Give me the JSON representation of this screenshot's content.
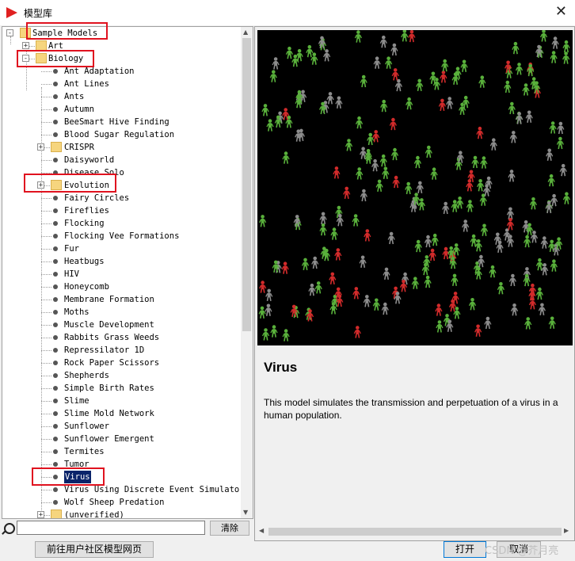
{
  "window": {
    "title": "模型库",
    "close_glyph": "✕",
    "app_icon": "netlogo-arrow-icon",
    "accent": "#e02020"
  },
  "tree": {
    "root": "Sample Models",
    "items": [
      {
        "label": "Sample Models",
        "level": 0,
        "kind": "folder",
        "expander": "-"
      },
      {
        "label": "Art",
        "level": 1,
        "kind": "folder",
        "expander": "+"
      },
      {
        "label": "Biology",
        "level": 1,
        "kind": "folder",
        "expander": "-"
      },
      {
        "label": "Ant Adaptation",
        "level": 2,
        "kind": "model"
      },
      {
        "label": "Ant Lines",
        "level": 2,
        "kind": "model"
      },
      {
        "label": "Ants",
        "level": 2,
        "kind": "model"
      },
      {
        "label": "Autumn",
        "level": 2,
        "kind": "model"
      },
      {
        "label": "BeeSmart Hive Finding",
        "level": 2,
        "kind": "model"
      },
      {
        "label": "Blood Sugar Regulation",
        "level": 2,
        "kind": "model"
      },
      {
        "label": "CRISPR",
        "level": 2,
        "kind": "folder",
        "expander": "+"
      },
      {
        "label": "Daisyworld",
        "level": 2,
        "kind": "model"
      },
      {
        "label": "Disease Solo",
        "level": 2,
        "kind": "model"
      },
      {
        "label": "Evolution",
        "level": 2,
        "kind": "folder",
        "expander": "+"
      },
      {
        "label": "Fairy Circles",
        "level": 2,
        "kind": "model"
      },
      {
        "label": "Fireflies",
        "level": 2,
        "kind": "model"
      },
      {
        "label": "Flocking",
        "level": 2,
        "kind": "model"
      },
      {
        "label": "Flocking Vee Formations",
        "level": 2,
        "kind": "model"
      },
      {
        "label": "Fur",
        "level": 2,
        "kind": "model"
      },
      {
        "label": "Heatbugs",
        "level": 2,
        "kind": "model"
      },
      {
        "label": "HIV",
        "level": 2,
        "kind": "model"
      },
      {
        "label": "Honeycomb",
        "level": 2,
        "kind": "model"
      },
      {
        "label": "Membrane Formation",
        "level": 2,
        "kind": "model"
      },
      {
        "label": "Moths",
        "level": 2,
        "kind": "model"
      },
      {
        "label": "Muscle Development",
        "level": 2,
        "kind": "model"
      },
      {
        "label": "Rabbits Grass Weeds",
        "level": 2,
        "kind": "model"
      },
      {
        "label": "Repressilator 1D",
        "level": 2,
        "kind": "model"
      },
      {
        "label": "Rock Paper Scissors",
        "level": 2,
        "kind": "model"
      },
      {
        "label": "Shepherds",
        "level": 2,
        "kind": "model"
      },
      {
        "label": "Simple Birth Rates",
        "level": 2,
        "kind": "model"
      },
      {
        "label": "Slime",
        "level": 2,
        "kind": "model"
      },
      {
        "label": "Slime Mold Network",
        "level": 2,
        "kind": "model"
      },
      {
        "label": "Sunflower",
        "level": 2,
        "kind": "model"
      },
      {
        "label": "Sunflower Emergent",
        "level": 2,
        "kind": "model"
      },
      {
        "label": "Termites",
        "level": 2,
        "kind": "model"
      },
      {
        "label": "Tumor",
        "level": 2,
        "kind": "model"
      },
      {
        "label": "Virus",
        "level": 2,
        "kind": "model",
        "selected": true
      },
      {
        "label": "Virus Using Discrete Event Simulator",
        "level": 2,
        "kind": "model"
      },
      {
        "label": "Wolf Sheep Predation",
        "level": 2,
        "kind": "model"
      },
      {
        "label": "(unverified)",
        "level": 2,
        "kind": "folder",
        "expander": "+"
      }
    ]
  },
  "preview": {
    "model_title": "Virus",
    "description": "This model simulates the transmission and perpetuation of a virus in a human population.",
    "colors": {
      "background": "#000000",
      "healthy": "#59b03b",
      "sick": "#d22b2b",
      "immune": "#8c8c8c"
    }
  },
  "search": {
    "value": "",
    "clear_label": "清除"
  },
  "buttons": {
    "community_label": "前往用户社区模型网页",
    "open_label": "打开",
    "cancel_label": "取消"
  },
  "watermark": "CSDN @芥月亮"
}
